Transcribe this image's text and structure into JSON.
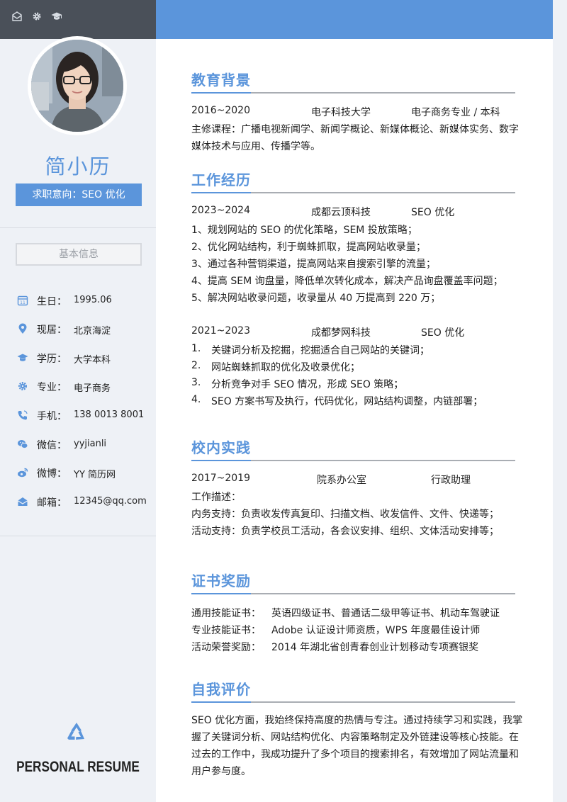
{
  "sidebar": {
    "top_icons": [
      "mail-icon",
      "gear-icon",
      "graduation-cap-icon"
    ],
    "name": "简小历",
    "intent": "求职意向：SEO 优化",
    "basic_info_title": "基本信息",
    "info": [
      {
        "icon": "calendar-icon",
        "label": "生日：",
        "value": "1995.06"
      },
      {
        "icon": "location-icon",
        "label": "现居：",
        "value": "北京海淀"
      },
      {
        "icon": "graduation-cap-icon",
        "label": "学历：",
        "value": "大学本科"
      },
      {
        "icon": "gear-icon",
        "label": "专业：",
        "value": "电子商务"
      },
      {
        "icon": "phone-icon",
        "label": "手机：",
        "value": "138 0013 8001"
      },
      {
        "icon": "wechat-icon",
        "label": "微信：",
        "value": "yyjianli"
      },
      {
        "icon": "weibo-icon",
        "label": "微博：",
        "value": "YY 简历网"
      },
      {
        "icon": "mail-icon",
        "label": "邮箱：",
        "value": "12345@qq.com"
      }
    ],
    "footer_icon": "recycle-icon",
    "footer_text": "PERSONAL RESUME"
  },
  "education": {
    "title": "教育背景",
    "period": "2016~2020",
    "school": "电子科技大学",
    "major": "电子商务专业 / 本科",
    "courses_1": "主修课程：广播电视新闻学、新闻学概论、新媒体概论、新媒体实务、数字",
    "courses_2": "媒体技术与应用、传播学等。"
  },
  "work": {
    "title": "工作经历",
    "jobs": [
      {
        "period": "2023~2024",
        "company": "成都云顶科技",
        "position": "SEO 优化",
        "duties": [
          "1、规划网站的 SEO 的优化策略，SEM 投放策略；",
          "2、优化网站结构，利于蜘蛛抓取，提高网站收录量；",
          "3、通过各种营销渠道，提高网站来自搜索引擎的流量；",
          "4、提高 SEM 询盘量，降低单次转化成本，解决产品询盘覆盖率问题；",
          "5、解决网站收录问题，收录量从 40 万提高到 220 万；"
        ]
      },
      {
        "period": "2021~2023",
        "company": "成都梦网科技",
        "position": "SEO 优化",
        "duties": [
          {
            "num": "1.",
            "text": "关键词分析及挖掘，挖掘适合自己网站的关键词；"
          },
          {
            "num": "2.",
            "text": "网站蜘蛛抓取的优化及收录优化；"
          },
          {
            "num": "3.",
            "text": "分析竞争对手 SEO 情况，形成 SEO 策略；"
          },
          {
            "num": "4.",
            "text": "SEO 方案书写及执行，代码优化，网站结构调整，内链部署；"
          }
        ]
      }
    ]
  },
  "campus": {
    "title": "校内实践",
    "period": "2017~2019",
    "org": "院系办公室",
    "role": "行政助理",
    "desc_label": "工作描述：",
    "lines": [
      "内务支持：负责收发传真复印、扫描文档、收发信件、文件、快递等；",
      "活动支持：负责学校员工活动，各会议安排、组织、文体活动安排等；"
    ]
  },
  "certs": {
    "title": "证书奖励",
    "items": [
      {
        "label": "通用技能证书：",
        "value": "英语四级证书、普通话二级甲等证书、机动车驾驶证"
      },
      {
        "label": "专业技能证书：",
        "value": "Adobe 认证设计师资质，WPS 年度最佳设计师"
      },
      {
        "label": "活动荣誉奖励：",
        "value": "2014 年湖北省创青春创业计划移动专项赛银奖"
      }
    ]
  },
  "self": {
    "title": "自我评价",
    "lines": [
      "SEO 优化方面，我始终保持高度的热情与专注。通过持续学习和实践，我掌",
      "握了关键词分析、网站结构优化、内容策略制定及外链建设等核心技能。在",
      "过去的工作中，我成功提升了多个项目的搜索排名，有效增加了网站流量和",
      "用户参与度。"
    ]
  },
  "colors": {
    "accent": "#5b95db",
    "sidebar_bg": "#eef1f6",
    "sidebar_top": "#4a5059",
    "rule_gray": "#a9adb3"
  }
}
